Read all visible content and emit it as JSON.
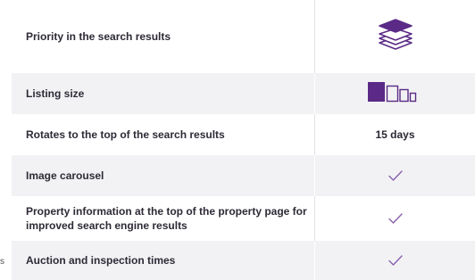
{
  "edge_text": "s",
  "colors": {
    "accent": "#5b2a86",
    "check": "#8a5fb0",
    "shaded_row": "#f2f2f4"
  },
  "rows": [
    {
      "label": "Priority in the search results",
      "value_type": "icon",
      "icon": "stack-layers-icon"
    },
    {
      "label": "Listing size",
      "value_type": "icon",
      "icon": "listing-size-icon"
    },
    {
      "label": "Rotates to the top of the search results",
      "value_type": "text",
      "value": "15 days"
    },
    {
      "label": "Image carousel",
      "value_type": "icon",
      "icon": "check-icon"
    },
    {
      "label": "Property information at the top of the property page for improved search engine results",
      "value_type": "icon",
      "icon": "check-icon"
    },
    {
      "label": "Auction and inspection times",
      "value_type": "icon",
      "icon": "check-icon"
    }
  ]
}
